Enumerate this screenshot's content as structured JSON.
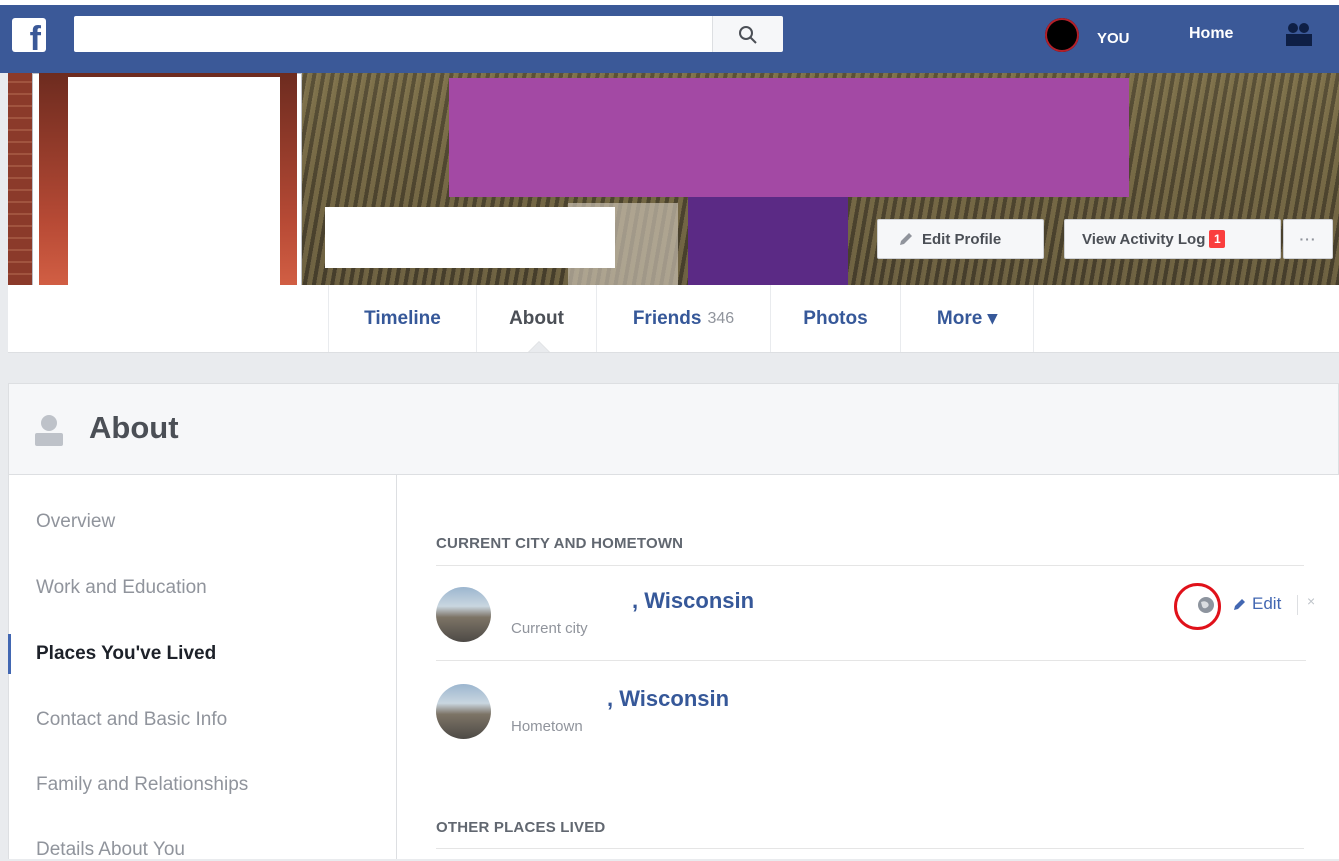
{
  "header": {
    "logo": "f",
    "search_placeholder": "",
    "user_label": "YOU",
    "home_label": "Home",
    "icons": [
      "facebook-logo",
      "search-icon",
      "friends-icon"
    ]
  },
  "cover": {
    "edit_profile_label": "Edit Profile",
    "activity_log_label": "View Activity Log",
    "activity_badge": "1",
    "more_dots": "···"
  },
  "tabs": [
    {
      "label": "Timeline",
      "count": ""
    },
    {
      "label": "About",
      "count": ""
    },
    {
      "label": "Friends",
      "count": "346"
    },
    {
      "label": "Photos",
      "count": ""
    },
    {
      "label": "More ▾",
      "count": ""
    }
  ],
  "about": {
    "title": "About",
    "sidebar": [
      "Overview",
      "Work and Education",
      "Places You've Lived",
      "Contact and Basic Info",
      "Family and Relationships",
      "Details About You"
    ],
    "active_index": 2,
    "current_section_title": "CURRENT CITY AND HOMETOWN",
    "places": [
      {
        "name": ", Wisconsin",
        "type": "Current city"
      },
      {
        "name": ", Wisconsin",
        "type": "Hometown"
      }
    ],
    "edit_label": "Edit",
    "close_label": "×",
    "other_section_title": "OTHER PLACES LIVED"
  },
  "colors": {
    "brand": "#3b5998",
    "link": "#365899",
    "highlight": "#e0111a",
    "redaction": "#a349a4"
  }
}
